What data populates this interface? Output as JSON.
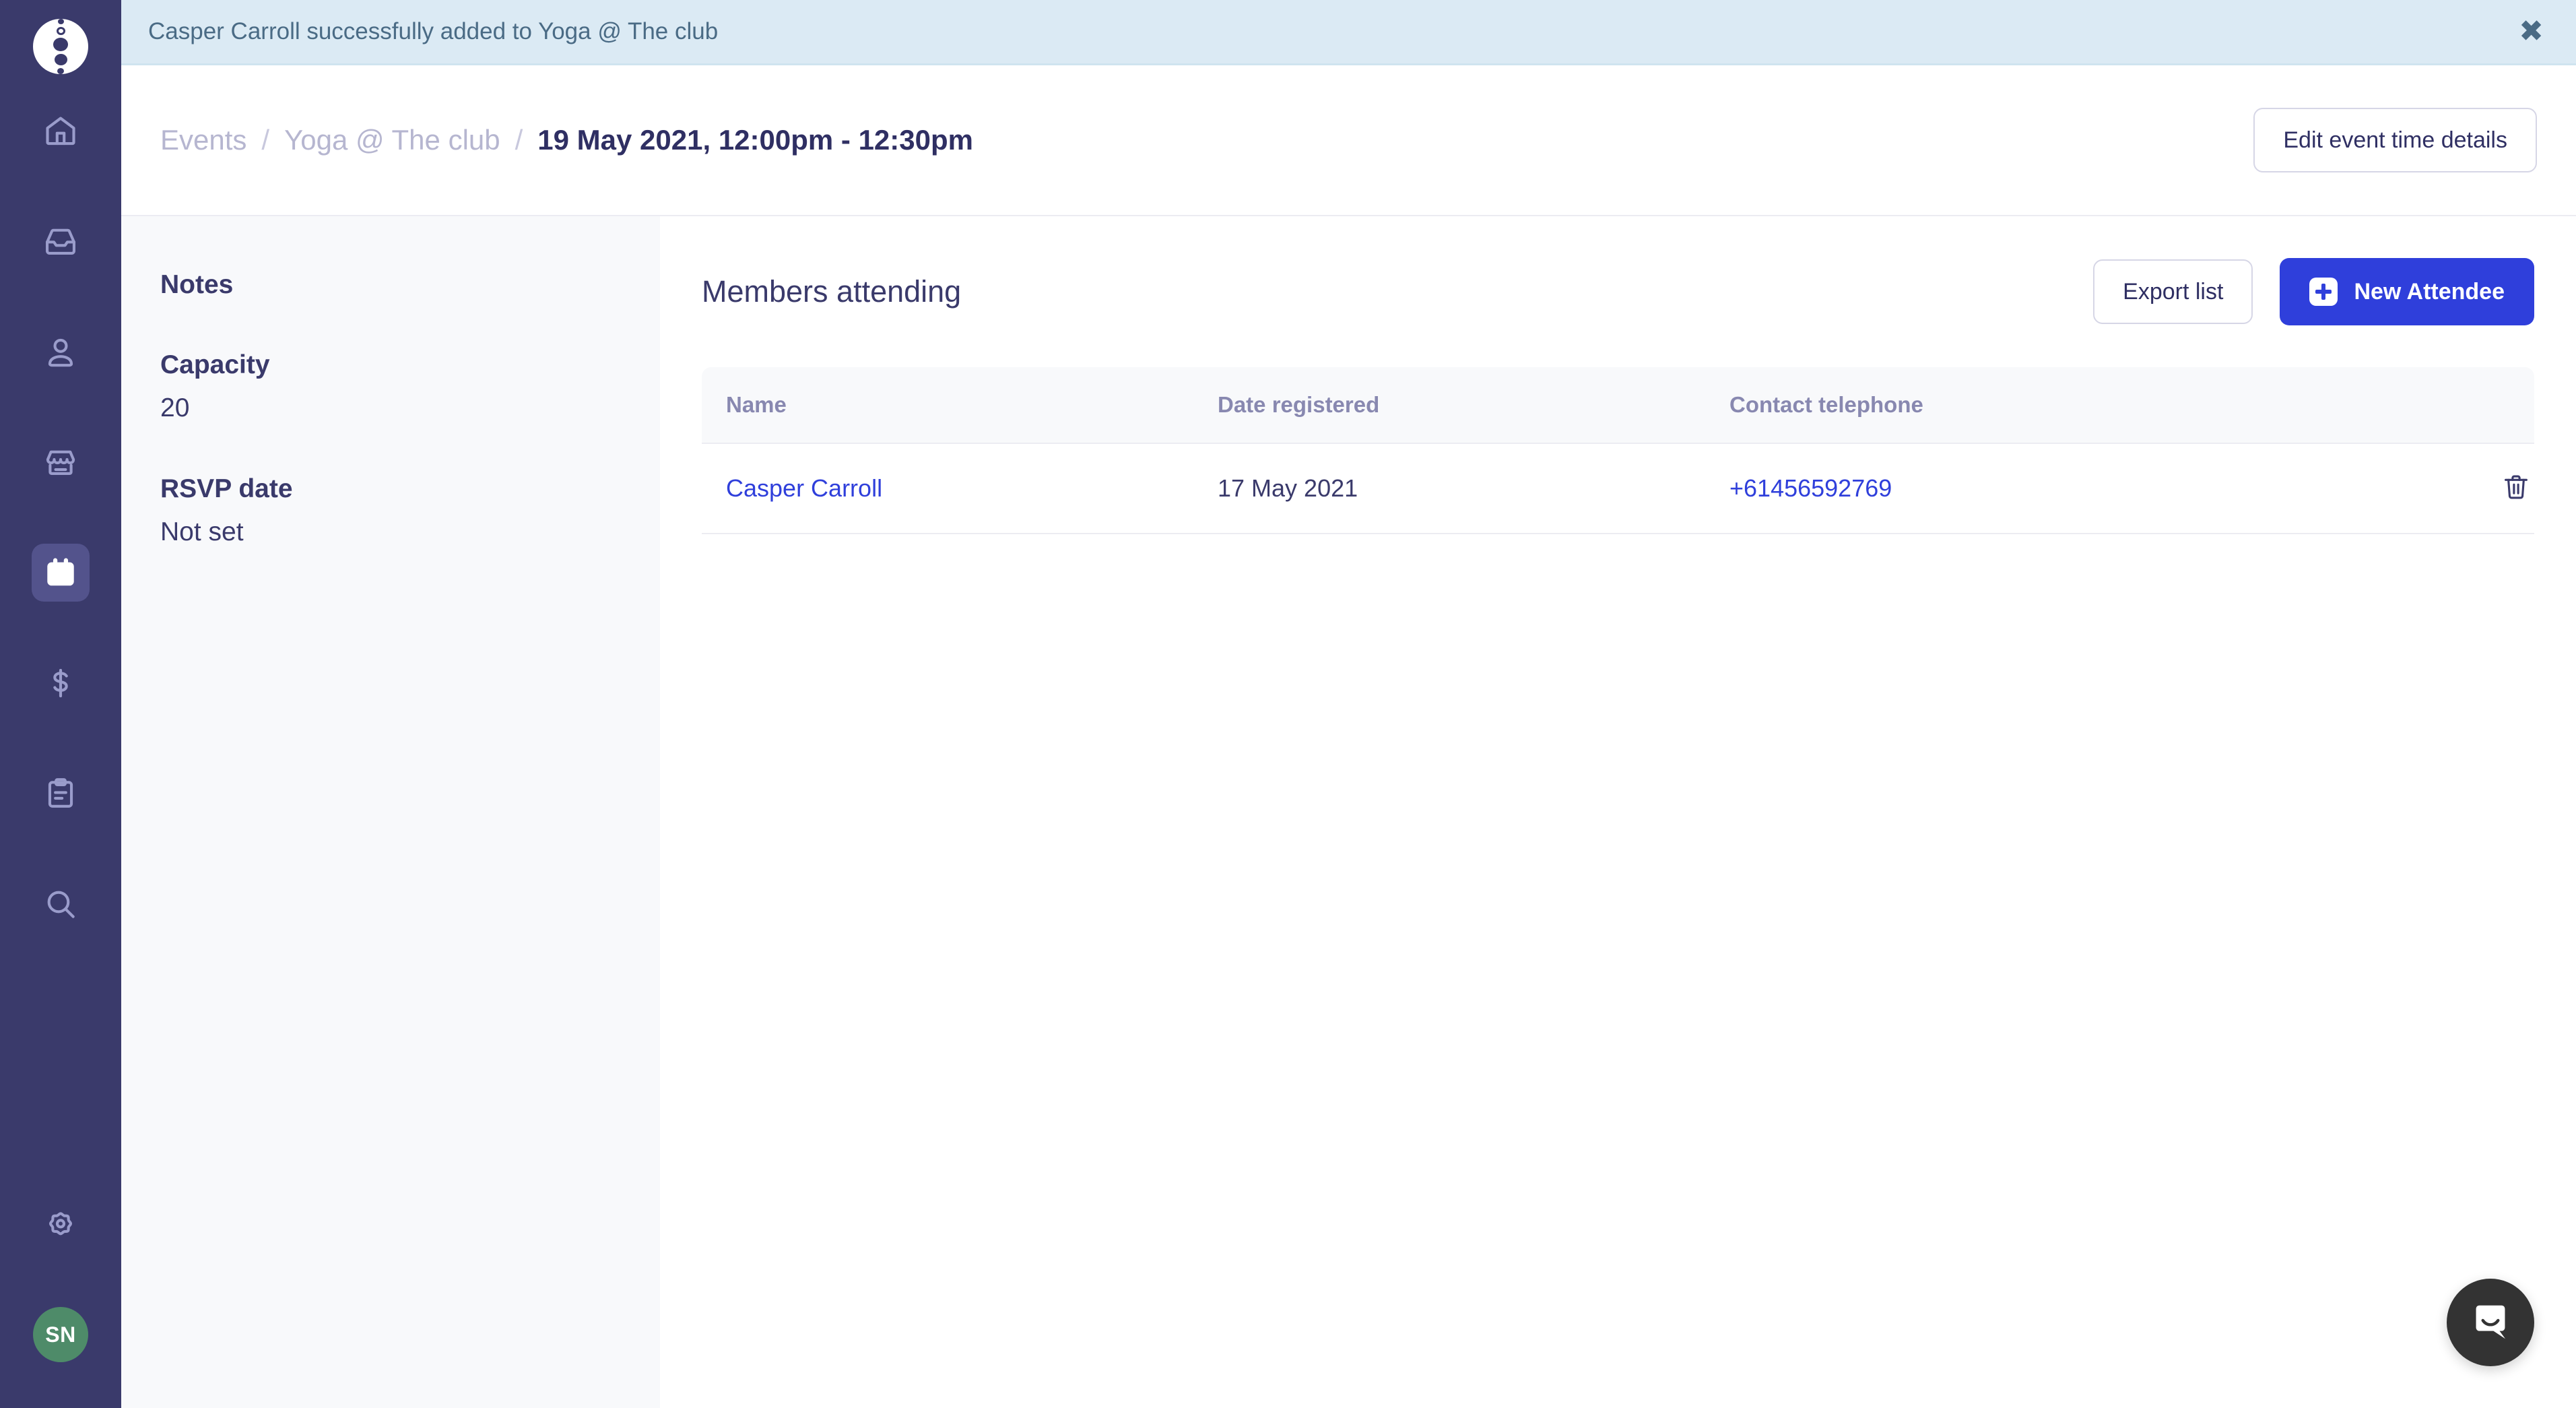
{
  "notification": {
    "message": "Casper Carroll successfully added to Yoga @ The club",
    "close_label": "✖",
    "bg_color": "#dbeaf4",
    "text_color": "#4a6b85"
  },
  "sidebar": {
    "logo_name": "app-logo",
    "bg_color": "#3a3a6b",
    "items": [
      {
        "name": "home",
        "icon": "home-icon",
        "active": false
      },
      {
        "name": "inbox",
        "icon": "inbox-icon",
        "active": false
      },
      {
        "name": "members",
        "icon": "user-icon",
        "active": false
      },
      {
        "name": "store",
        "icon": "store-icon",
        "active": false
      },
      {
        "name": "events",
        "icon": "calendar-icon",
        "active": true
      },
      {
        "name": "payments",
        "icon": "dollar-icon",
        "active": false
      },
      {
        "name": "reports",
        "icon": "clipboard-icon",
        "active": false
      },
      {
        "name": "search",
        "icon": "search-icon",
        "active": false
      }
    ],
    "settings_icon": "gear-icon",
    "avatar_initials": "SN",
    "avatar_color": "#4e8b69"
  },
  "header": {
    "breadcrumb": {
      "root": "Events",
      "parent": "Yoga @ The club",
      "current": "19 May 2021, 12:00pm - 12:30pm",
      "separator": "/"
    },
    "edit_button": "Edit event time details"
  },
  "notes_panel": {
    "title": "Notes",
    "fields": [
      {
        "label": "Capacity",
        "value": "20"
      },
      {
        "label": "RSVP date",
        "value": "Not set"
      }
    ]
  },
  "main": {
    "title": "Members attending",
    "export_button": "Export list",
    "new_attendee_button": "New Attendee",
    "primary_color": "#2f3fdb",
    "table": {
      "columns": [
        "Name",
        "Date registered",
        "Contact telephone"
      ],
      "rows": [
        {
          "name": "Casper Carroll",
          "date_registered": "17 May 2021",
          "contact_telephone": "+61456592769",
          "delete_icon": "trash-icon"
        }
      ]
    }
  },
  "messenger": {
    "icon": "intercom-chat-icon",
    "color": "#333333"
  }
}
